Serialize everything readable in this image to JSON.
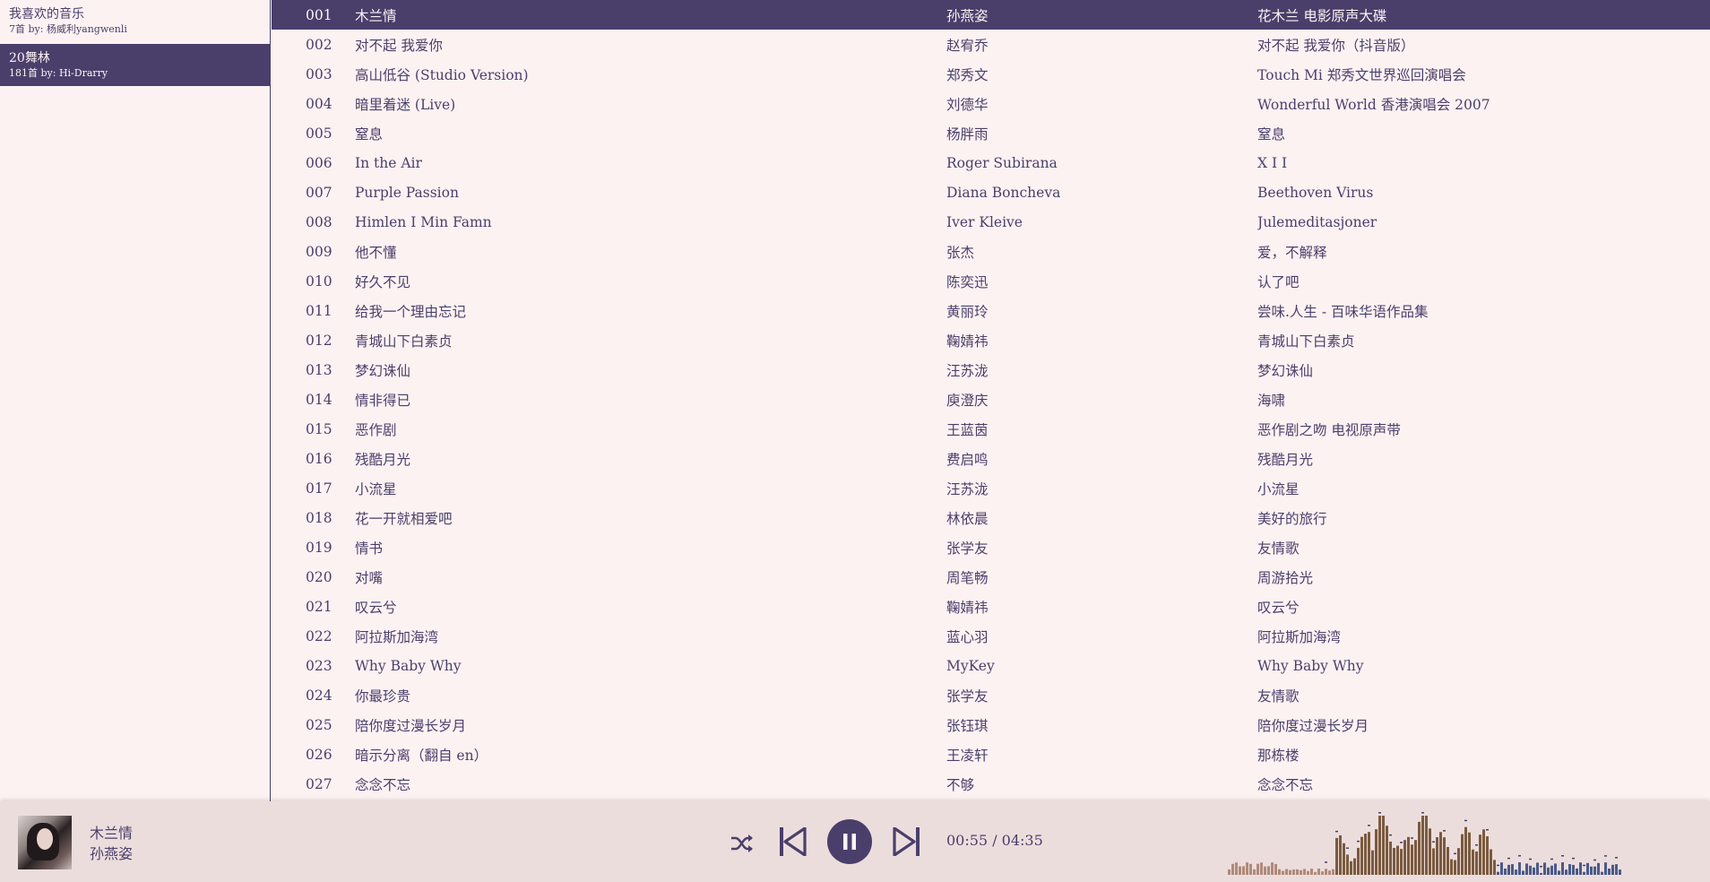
{
  "sidebar": {
    "playlists": [
      {
        "name": "我喜欢的音乐",
        "sub": "7首 by: 杨威利yangwenli",
        "active": false
      },
      {
        "name": "20舞林",
        "sub": "181首 by: Hi-Drarry",
        "active": true
      }
    ]
  },
  "tracks": [
    {
      "num": "001",
      "title": "木兰情",
      "artist": "孙燕姿",
      "album": "花木兰 电影原声大碟",
      "active": true
    },
    {
      "num": "002",
      "title": "对不起 我爱你",
      "artist": "赵宥乔",
      "album": "对不起 我爱你（抖音版）"
    },
    {
      "num": "003",
      "title": "高山低谷 (Studio Version)",
      "artist": "郑秀文",
      "album": "Touch Mi 郑秀文世界巡回演唱会"
    },
    {
      "num": "004",
      "title": "暗里着迷 (Live)",
      "artist": "刘德华",
      "album": "Wonderful World 香港演唱会 2007"
    },
    {
      "num": "005",
      "title": "窒息",
      "artist": "杨胖雨",
      "album": "窒息"
    },
    {
      "num": "006",
      "title": "In the Air",
      "artist": "Roger Subirana",
      "album": "X I I"
    },
    {
      "num": "007",
      "title": "Purple Passion",
      "artist": "Diana Boncheva",
      "album": "Beethoven Virus"
    },
    {
      "num": "008",
      "title": "Himlen I Min Famn",
      "artist": "Iver Kleive",
      "album": "Julemeditasjoner"
    },
    {
      "num": "009",
      "title": "他不懂",
      "artist": "张杰",
      "album": "爱，不解释"
    },
    {
      "num": "010",
      "title": "好久不见",
      "artist": "陈奕迅",
      "album": "认了吧"
    },
    {
      "num": "011",
      "title": "给我一个理由忘记",
      "artist": "黄丽玲",
      "album": "尝味.人生 - 百味华语作品集"
    },
    {
      "num": "012",
      "title": "青城山下白素贞",
      "artist": "鞠婧祎",
      "album": "青城山下白素贞"
    },
    {
      "num": "013",
      "title": "梦幻诛仙",
      "artist": "汪苏泷",
      "album": "梦幻诛仙"
    },
    {
      "num": "014",
      "title": "情非得已",
      "artist": "庾澄庆",
      "album": "海啸"
    },
    {
      "num": "015",
      "title": "恶作剧",
      "artist": "王蓝茵",
      "album": "恶作剧之吻 电视原声带"
    },
    {
      "num": "016",
      "title": "残酷月光",
      "artist": "费启鸣",
      "album": "残酷月光"
    },
    {
      "num": "017",
      "title": "小流星",
      "artist": "汪苏泷",
      "album": "小流星"
    },
    {
      "num": "018",
      "title": "花一开就相爱吧",
      "artist": "林依晨",
      "album": "美好的旅行"
    },
    {
      "num": "019",
      "title": "情书",
      "artist": "张学友",
      "album": "友情歌"
    },
    {
      "num": "020",
      "title": "对嘴",
      "artist": "周笔畅",
      "album": "周游拾光"
    },
    {
      "num": "021",
      "title": "叹云兮",
      "artist": "鞠婧祎",
      "album": "叹云兮"
    },
    {
      "num": "022",
      "title": "阿拉斯加海湾",
      "artist": "蓝心羽",
      "album": "阿拉斯加海湾"
    },
    {
      "num": "023",
      "title": "Why Baby Why",
      "artist": "MyKey",
      "album": "Why Baby Why"
    },
    {
      "num": "024",
      "title": "你最珍贵",
      "artist": "张学友",
      "album": "友情歌"
    },
    {
      "num": "025",
      "title": "陪你度过漫长岁月",
      "artist": "张钰琪",
      "album": "陪你度过漫长岁月"
    },
    {
      "num": "026",
      "title": "暗示分离（翻自 en）",
      "artist": "王凌轩",
      "album": "那栋楼"
    },
    {
      "num": "027",
      "title": "念念不忘",
      "artist": "不够",
      "album": "念念不忘"
    }
  ],
  "player": {
    "title": "木兰情",
    "artist": "孙燕姿",
    "time": "00:55 / 04:35",
    "state": "playing",
    "icons": [
      "shuffle-icon",
      "previous-icon",
      "pause-icon",
      "next-icon"
    ],
    "accent": "#4a3f6b",
    "background": "#fdf2f2"
  }
}
